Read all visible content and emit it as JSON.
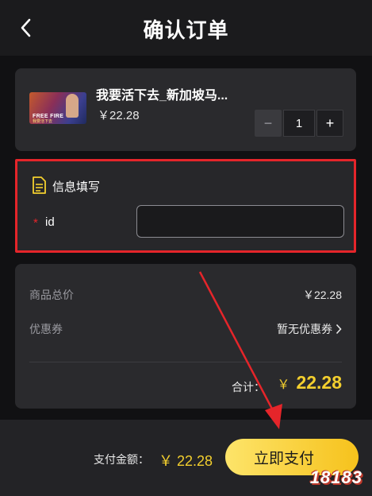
{
  "header": {
    "title": "确认订单"
  },
  "product": {
    "name": "我要活下去_新加坡马...",
    "price": "￥22.28",
    "quantity": "1",
    "minus": "−",
    "plus": "+",
    "thumbnail_text": "FREE FIRE",
    "thumbnail_sub": "我要活下去"
  },
  "info": {
    "title": "信息填写",
    "required_mark": "*",
    "id_label": "id",
    "id_value": "",
    "id_placeholder": ""
  },
  "summary": {
    "goods_total_label": "商品总价",
    "goods_total_value": "￥22.28",
    "coupon_label": "优惠券",
    "coupon_value": "暂无优惠券",
    "total_label": "合计：",
    "total_currency": "￥",
    "total_value": "22.28"
  },
  "bottom": {
    "pay_label": "支付金额：",
    "pay_amount": "￥ 22.28",
    "pay_button": "立即支付"
  },
  "watermark": "18183",
  "colors": {
    "accent": "#f3cf2e",
    "highlight": "#e5252a",
    "background": "#111113",
    "card": "#2a2a2d"
  }
}
